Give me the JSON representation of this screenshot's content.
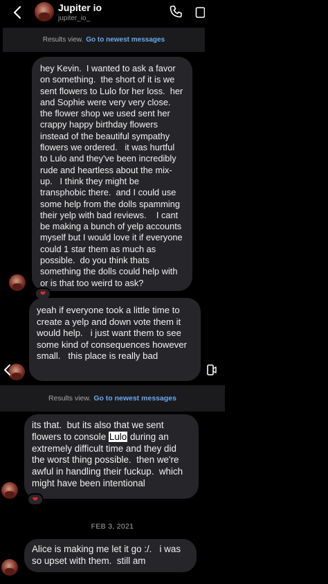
{
  "header": {
    "title": "Jupiter io",
    "subtitle": "jupiter_io_"
  },
  "results_bar": {
    "text": "Results view.",
    "link": "Go to newest messages"
  },
  "messages": {
    "m1": "hey Kevin.  I wanted to ask a favor on something.  the short of it is we sent flowers to Lulo for her loss.  her and Sophie were very very close.  the flower shop we used sent her crappy happy birthday flowers instead of the beautiful sympathy flowers we ordered.   it was hurtful to Lulo and they've been incredibly rude and heartless about the mix-up.   I think they might be transphobic there.  and I could use some help from the dolls spamming their yelp with bad reviews.    I cant be making a bunch of yelp accounts myself but I would love it if everyone could 1 star them as much as possible.  do you think thats something the dolls could help with or is that too weird to ask?",
    "m2": "yeah if everyone took a little time to create a yelp and down vote them it would help.   i just want them to see some kind of consequences however small.   this place is really bad",
    "m3_before": "its that.  but its also that we sent flowers to console ",
    "m3_highlight": "Lulo",
    "m3_after": " during an extremely difficult time and they did the worst thing possible.  then we're awful in handling their fuckup.  which might have been intentional",
    "m4": "Alice is making me let it go :/.   i was so upset with them.  still am"
  },
  "reaction": "❤",
  "date_separator": "FEB 3, 2021",
  "colors": {
    "background": "#000000",
    "bubble": "#26262a",
    "link": "#6aa8f0",
    "reaction": "#e8242f"
  }
}
